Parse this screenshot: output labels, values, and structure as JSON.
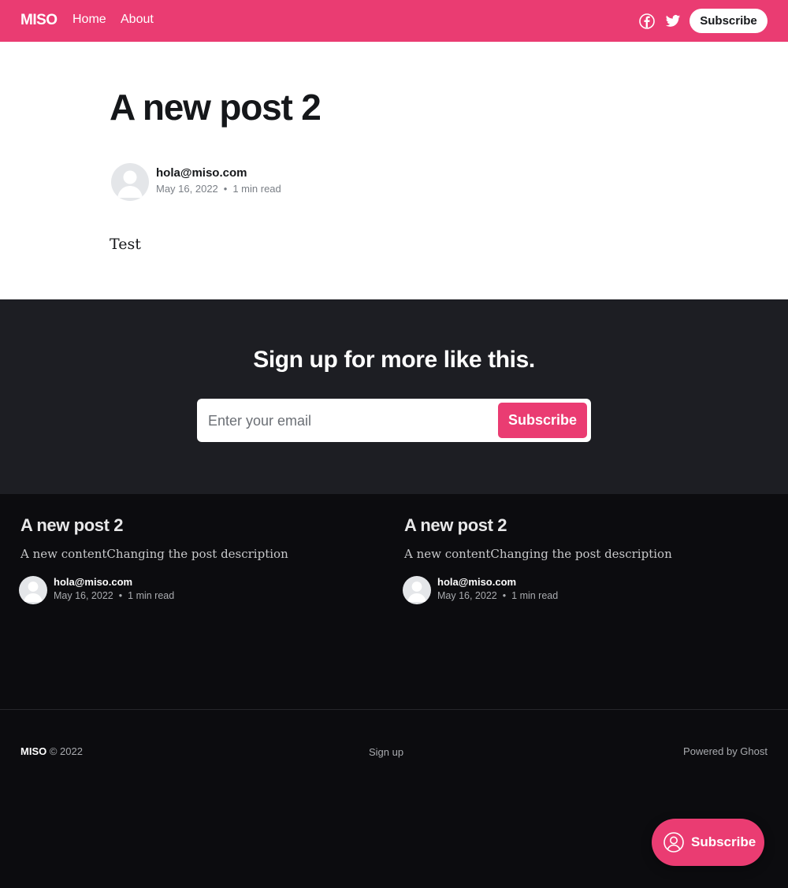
{
  "header": {
    "logo": "MISO",
    "nav": [
      {
        "label": "Home"
      },
      {
        "label": "About"
      }
    ],
    "social_icons": [
      "facebook-icon",
      "twitter-icon"
    ],
    "subscribe_label": "Subscribe",
    "accent_color": "#ea3c72"
  },
  "article": {
    "title": "A new post 2",
    "author": "hola@miso.com",
    "date": "May 16, 2022",
    "separator": "•",
    "read_time": "1 min read",
    "body": "Test"
  },
  "cta": {
    "title": "Sign up for more like this.",
    "email_placeholder": "Enter your email",
    "button_label": "Subscribe"
  },
  "related": [
    {
      "title": "A new post 2",
      "excerpt": "A new contentChanging the post description",
      "author": "hola@miso.com",
      "date": "May 16, 2022",
      "read_time": "1 min read"
    },
    {
      "title": "A new post 2",
      "excerpt": "A new contentChanging the post description",
      "author": "hola@miso.com",
      "date": "May 16, 2022",
      "read_time": "1 min read"
    }
  ],
  "footer": {
    "brand": "MISO",
    "copyright": "© 2022",
    "signup_link": "Sign up",
    "powered_by": "Powered by Ghost"
  },
  "portal": {
    "label": "Subscribe"
  }
}
